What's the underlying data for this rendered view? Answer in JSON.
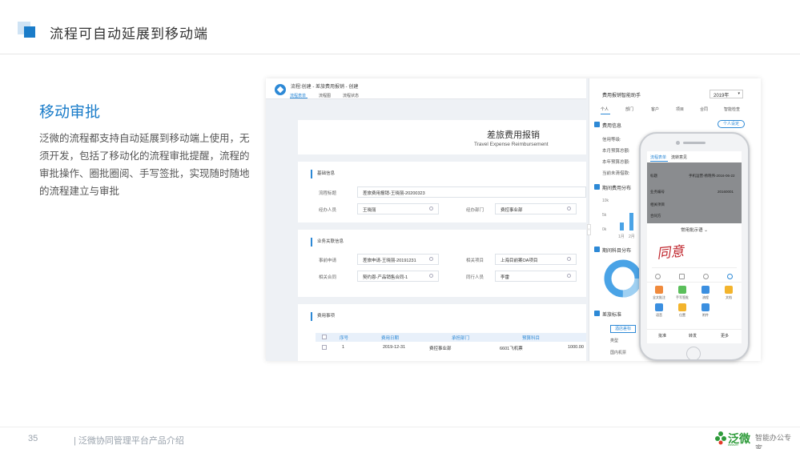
{
  "header": {
    "title": "流程可自动延展到移动端"
  },
  "section": {
    "title": "移动审批",
    "description": "泛微的流程都支持自动延展到移动端上使用，无须开发，包括了移动化的流程审批提醒，流程的审批操作、圈批圈阅、手写签批，实现随时随地的流程建立与审批"
  },
  "footer": {
    "page_number": "35",
    "text": "| 泛微协同管理平台产品介绍",
    "logo_brand": "泛微",
    "logo_brand_en": "weaver",
    "logo_slogan": "智能办公专家"
  },
  "desktop": {
    "breadcrumb": "流程:创建 - 差旅费用报销 - 创建",
    "tabs": [
      "流程表单",
      "流程图",
      "流程状态"
    ],
    "form_title": "差旅费用报销",
    "form_subtitle": "Travel Expense Reimbursement",
    "basic": {
      "heading": "基础信息",
      "flow_title_label": "流程标题",
      "flow_title_value": "差旅费用报销-王晓丽-20200323",
      "handler_label": "经办人员",
      "handler_value": "王晓丽",
      "dept_label": "经办部门",
      "dept_value": "费控事业部"
    },
    "related": {
      "heading": "业务关联信息",
      "request_label": "事前申请",
      "request_value": "差旅申请-王晓丽-20191231",
      "project_label": "相关项目",
      "project_value": "上海目前案OA项目",
      "contract_label": "相关合同",
      "contract_value": "契约恩-产品销售合同-1",
      "companion_label": "同行人员",
      "companion_value": "李雷"
    },
    "expense": {
      "heading": "费用事项",
      "columns": [
        "序号",
        "费用日期",
        "承担部门",
        "预算科目"
      ],
      "row": {
        "index": "1",
        "date": "2019-12-31",
        "dept": "费控事业部",
        "subject": "6601飞机票",
        "amount": "1000.00"
      }
    }
  },
  "analytics": {
    "title": "费用报销智能助手",
    "year": "2019年",
    "tabs": [
      "个人",
      "部门",
      "客户",
      "项目",
      "合同",
      "智能检查"
    ],
    "info_heading": "费用信息",
    "personal_btn": "个人设定",
    "rows": [
      "信用等级:",
      "本月预算总额:",
      "本年预算总额:",
      "当前未清借款:"
    ],
    "trend_heading": "期间费用分布",
    "y_ticks": [
      "10k",
      "5k",
      "0k"
    ],
    "x_ticks": [
      "1月",
      "2月"
    ],
    "subject_heading": "期间科目分布",
    "std_heading": "差旅标准",
    "std_btn": "酒店差标",
    "std_cols": [
      "类型",
      "国内机票"
    ]
  },
  "mobile": {
    "tabs": [
      "流程表单",
      "流转意见"
    ],
    "line1_label": "标题",
    "line1_value": "手机运营-杨晓伟-2016-06-22",
    "line2_label": "业务编号",
    "line2_value": "20160001",
    "line3_label": "相关项目",
    "line4_label": "合同方",
    "sheet_title": "常用批示语",
    "signature": "同意",
    "grid": [
      "全文批注",
      "手写签批",
      "流程",
      "文档",
      "语音",
      "位置",
      "附件"
    ],
    "actions": [
      "批准",
      "转发",
      "更多"
    ]
  }
}
